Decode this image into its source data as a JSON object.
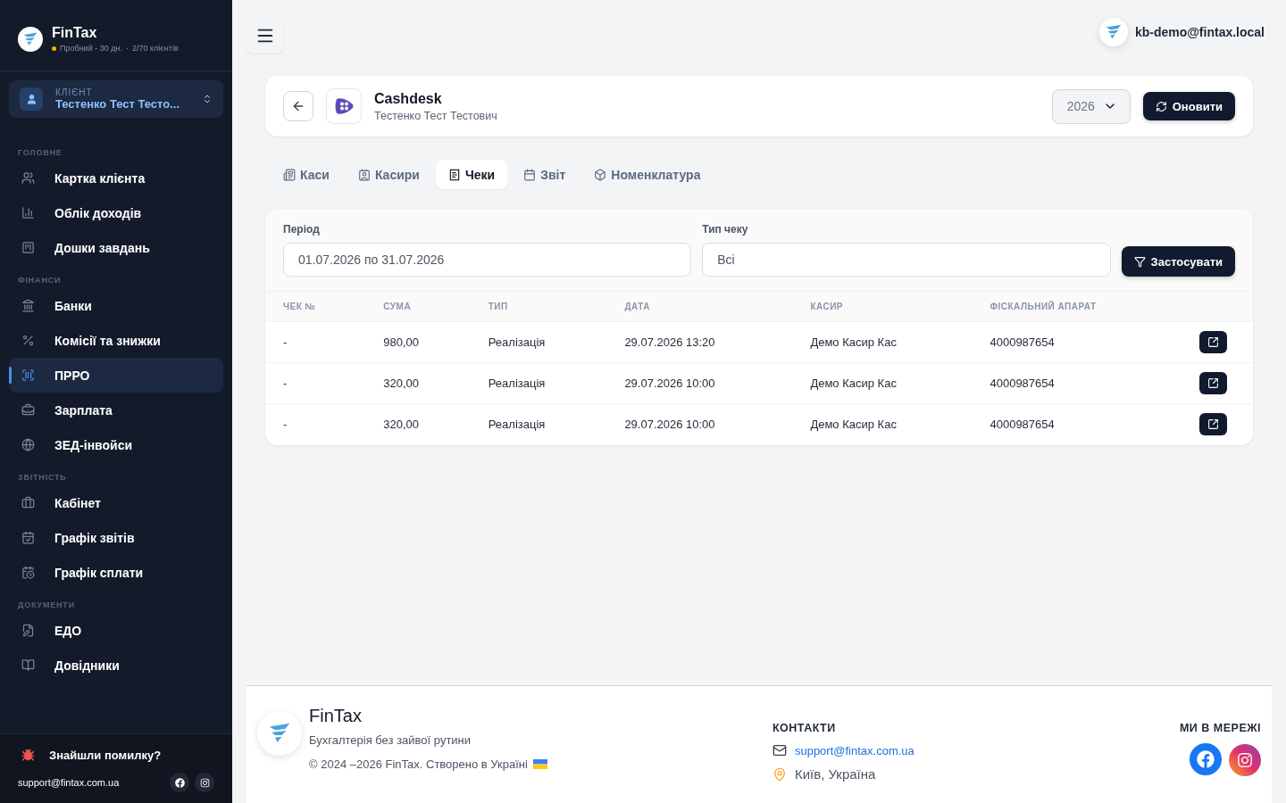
{
  "brand": {
    "name": "FinTax",
    "plan": "Пробний - 30 дн.",
    "separator": "·",
    "clients": "2/70 клієнтів"
  },
  "client": {
    "label": "КЛІЄНТ",
    "name": "Тестенко Тест Тесто..."
  },
  "sidebar": {
    "sections": [
      {
        "title": "ГОЛОВНЕ",
        "items": [
          {
            "label": "Картка клієнта",
            "selected": false
          },
          {
            "label": "Облік доходів",
            "selected": false
          },
          {
            "label": "Дошки завдань",
            "selected": false
          }
        ]
      },
      {
        "title": "ФІНАНСИ",
        "items": [
          {
            "label": "Банки",
            "selected": false
          },
          {
            "label": "Комісії та знижки",
            "selected": false
          },
          {
            "label": "ПРРО",
            "selected": true
          },
          {
            "label": "Зарплата",
            "selected": false
          },
          {
            "label": "ЗЕД-інвойси",
            "selected": false
          }
        ]
      },
      {
        "title": "ЗВІТНІСТЬ",
        "items": [
          {
            "label": "Кабінет",
            "selected": false
          },
          {
            "label": "Графік звітів",
            "selected": false
          },
          {
            "label": "Графік сплати",
            "selected": false
          }
        ]
      },
      {
        "title": "ДОКУМЕНТИ",
        "items": [
          {
            "label": "ЕДО",
            "selected": false
          },
          {
            "label": "Довідники",
            "selected": false
          }
        ]
      }
    ]
  },
  "sidebar_footer": {
    "bug_report": "Знайшли помилку?",
    "email": "support@fintax.com.ua"
  },
  "topbar": {
    "user": "kb-demo@fintax.local"
  },
  "header": {
    "title": "Cashdesk",
    "subtitle": "Тестенко Тест Тестович",
    "year": "2026",
    "refresh": "Оновити"
  },
  "tabs": [
    {
      "label": "Каси",
      "selected": false
    },
    {
      "label": "Касири",
      "selected": false
    },
    {
      "label": "Чеки",
      "selected": true
    },
    {
      "label": "Звіт",
      "selected": false
    },
    {
      "label": "Номенклатура",
      "selected": false
    }
  ],
  "filters": {
    "period_label": "Період",
    "period_value": "01.07.2026 по 31.07.2026",
    "type_label": "Тип чеку",
    "type_value": "Всі",
    "apply": "Застосувати"
  },
  "table": {
    "columns": [
      "ЧЕК №",
      "СУМА",
      "ТИП",
      "ДАТА",
      "КАСИР",
      "ФІСКАЛЬНИЙ АПАРАТ"
    ],
    "rows": [
      [
        "-",
        "980,00",
        "Реалізація",
        "29.07.2026 13:20",
        "Демо Касир Кас",
        "4000987654"
      ],
      [
        "-",
        "320,00",
        "Реалізація",
        "29.07.2026 10:00",
        "Демо Касир Кас",
        "4000987654"
      ],
      [
        "-",
        "320,00",
        "Реалізація",
        "29.07.2026 10:00",
        "Демо Касир Кас",
        "4000987654"
      ]
    ]
  },
  "footer": {
    "name": "FinTax",
    "tagline": "Бухгалтерія без зайвої рутини",
    "copyright": "© 2024 –2026 FinTax. Створено в Україні",
    "contacts_title": "КОНТАКТИ",
    "email": "support@fintax.com.ua",
    "city": "Київ, Україна",
    "social_title": "МИ В МЕРЕЖІ"
  }
}
